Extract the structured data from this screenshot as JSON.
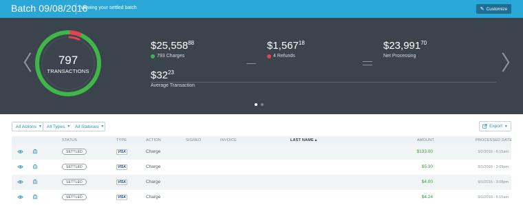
{
  "topbar": {
    "title": "Batch 09/08/2016",
    "subtitle": "Viewing your settled batch",
    "customize_label": "Customize"
  },
  "summary": {
    "transactions_count": "797",
    "transactions_label": "TRANSACTIONS",
    "ring_refund_fraction": 0.005,
    "charges_amount": "$25,558",
    "charges_cents": "88",
    "charges_label": "793 Charges",
    "refunds_amount": "$1,567",
    "refunds_cents": "18",
    "refunds_label": "4 Refunds",
    "net_amount": "$23,991",
    "net_cents": "70",
    "net_label": "Net Processing",
    "avg_amount": "$32",
    "avg_cents": "23",
    "avg_label": "Average Transaction",
    "pager_total": 2,
    "pager_active": 1
  },
  "filters": {
    "actions": "All Actions",
    "types": "All Types",
    "statuses": "All Statuses",
    "export": "Export"
  },
  "table": {
    "columns": {
      "status": "STATUS",
      "type": "TYPE",
      "action": "ACTION",
      "signed": "SIGNED",
      "invoice": "INVOICE",
      "last_name": "LAST NAME ▴",
      "amount": "AMOUNT",
      "processed_date": "PROCESSED DATE"
    },
    "rows": [
      {
        "status": "SETTLED",
        "type": "VISA",
        "action": "Charge",
        "amount": "$133.00",
        "date": "9/2/2016 - 6:15am"
      },
      {
        "status": "SETTLED",
        "type": "VISA",
        "action": "Charge",
        "amount": "$5.30",
        "date": "9/1/2016 - 3:09pm"
      },
      {
        "status": "SETTLED",
        "type": "VISA",
        "action": "Charge",
        "amount": "$4.00",
        "date": "9/1/2016 - 3:08pm"
      },
      {
        "status": "SETTLED",
        "type": "VISA",
        "action": "Charge",
        "amount": "$4.24",
        "date": "9/1/2016 - 6:15am"
      }
    ]
  },
  "colors": {
    "topbar": "#2aa6d7",
    "hero": "#3b444c",
    "charges": "#40b649",
    "refunds": "#e24353",
    "link": "#2a8fbf"
  },
  "icons": {
    "prev": "chevron-left-icon",
    "next": "chevron-right-icon",
    "view": "eye-icon",
    "receipt": "bank-icon",
    "customize": "pencil-icon",
    "export": "export-icon"
  }
}
